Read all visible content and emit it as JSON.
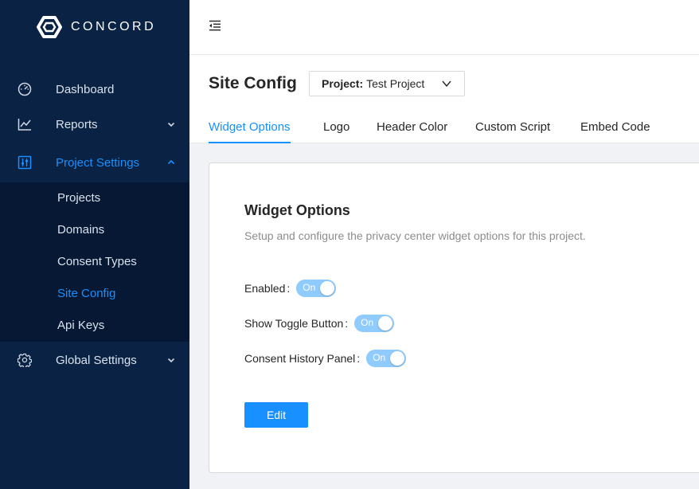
{
  "app": {
    "brand": "CONCORD",
    "logo_icon": "concord-logo-icon"
  },
  "sidebar": {
    "items": [
      {
        "label": "Dashboard",
        "icon": "dashboard-icon"
      },
      {
        "label": "Reports",
        "icon": "line-chart-icon"
      },
      {
        "label": "Project Settings",
        "icon": "sliders-icon"
      },
      {
        "label": "Global Settings",
        "icon": "gear-icon"
      }
    ],
    "project_settings_sub": [
      {
        "label": "Projects"
      },
      {
        "label": "Domains"
      },
      {
        "label": "Consent Types"
      },
      {
        "label": "Site Config"
      },
      {
        "label": "Api Keys"
      }
    ]
  },
  "page": {
    "title": "Site Config",
    "project_select": {
      "label": "Project:",
      "value": "Test Project"
    },
    "tabs": [
      {
        "label": "Widget Options"
      },
      {
        "label": "Logo"
      },
      {
        "label": "Header Color"
      },
      {
        "label": "Custom Script"
      },
      {
        "label": "Embed Code"
      }
    ]
  },
  "widget_options": {
    "title": "Widget Options",
    "description": "Setup and configure the privacy center widget options for this project.",
    "options": [
      {
        "label": "Enabled",
        "state": "On"
      },
      {
        "label": "Show Toggle Button",
        "state": "On"
      },
      {
        "label": "Consent History Panel",
        "state": "On"
      }
    ],
    "edit_label": "Edit"
  },
  "colors": {
    "sidebar_bg": "#0a2244",
    "submenu_bg": "#061833",
    "accent": "#1890ff",
    "switch_disabled_on": "#8fcbfd"
  }
}
